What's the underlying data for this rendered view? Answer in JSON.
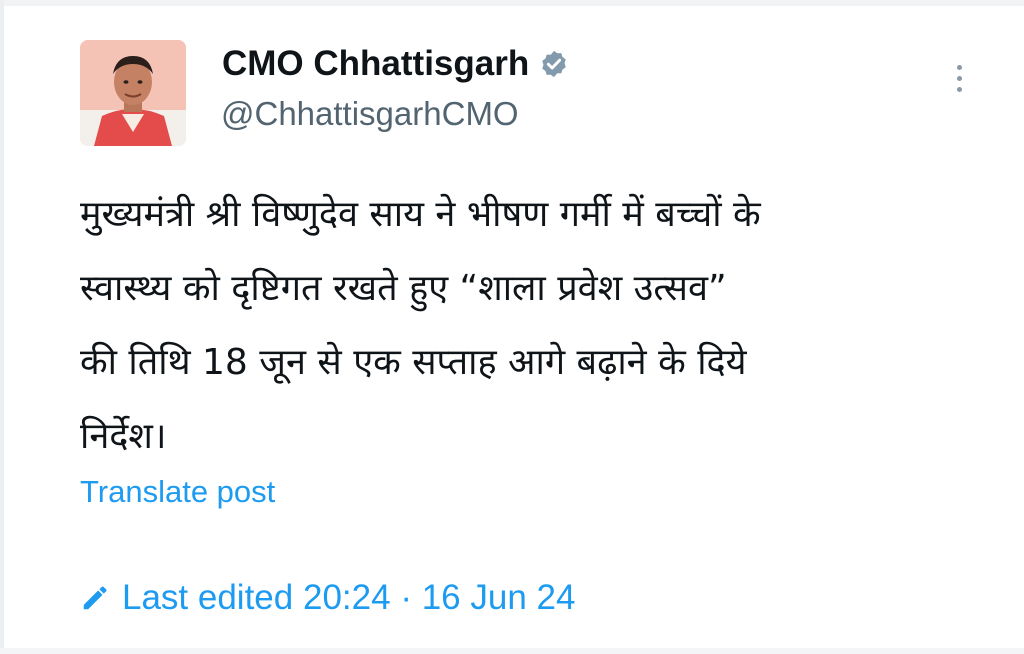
{
  "post": {
    "author": {
      "display_name": "CMO Chhattisgarh",
      "handle": "@ChhattisgarhCMO",
      "verified": true
    },
    "text": "मुख्यमंत्री श्री विष्णुदेव साय ने भीषण गर्मी में बच्चों के\nस्वास्थ्य को दृष्टिगत रखते हुए “शाला प्रवेश उत्सव”\nकी तिथि 18 जून से एक सप्ताह आगे बढ़ाने के दिये\nनिर्देश।",
    "translate_label": "Translate post",
    "edited": {
      "label": "Last edited",
      "time": "20:24",
      "separator": "·",
      "date": "16 Jun 24"
    }
  },
  "icons": {
    "verified": "verified-badge-icon",
    "more": "more-options-icon",
    "edited": "pencil-icon"
  },
  "colors": {
    "link": "#1d9bf0",
    "secondary_text": "#536471",
    "primary_text": "#0f1419",
    "verified_badge": "#829aab"
  }
}
